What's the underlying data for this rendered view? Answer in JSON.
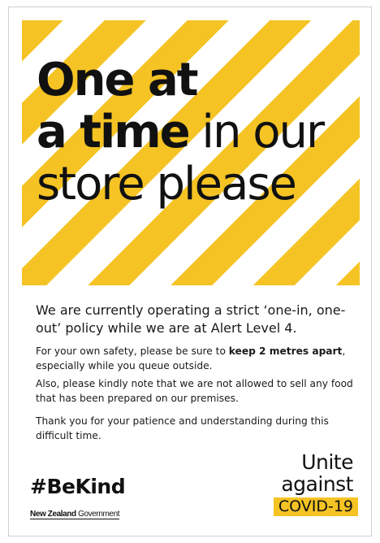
{
  "headline": {
    "line1": "One at",
    "line2_bold": "a time",
    "line2_rest": " in our",
    "line3": "store please"
  },
  "lead": "We are currently operating a strict ‘one-in, one-out’ policy while we are at Alert Level 4.",
  "paragraphs": {
    "p1_before": "For your own safety, please be sure to ",
    "p1_bold": "keep 2 metres apart",
    "p1_after": ", especially while you queue outside.",
    "p2": "Also, please kindly note that we are not allowed to sell any food that has been prepared on our premises.",
    "p3": "Thank you for your patience and understanding during this difficult time."
  },
  "hashtag": "#BeKind",
  "government": {
    "part1": "New Zealand",
    "part2": " Government"
  },
  "unite": {
    "line1": "Unite",
    "line2": "against",
    "box": "COVID-19"
  },
  "colors": {
    "stripe_yellow": "#f5c324",
    "text": "#111111"
  }
}
